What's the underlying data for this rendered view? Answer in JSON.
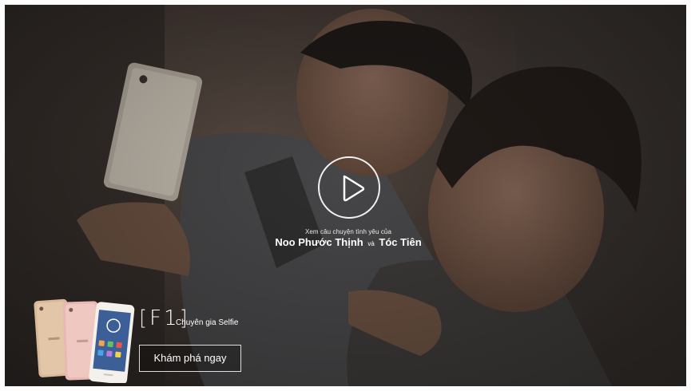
{
  "video": {
    "caption_line1": "Xem câu chuyện tình yêu của",
    "caption_name1": "Noo Phước Thịnh",
    "caption_connector": "và",
    "caption_name2": "Tóc Tiên",
    "play_icon": "play-icon"
  },
  "promo": {
    "logo_text": "F1",
    "tagline": "Chuyên gia Selfie",
    "cta_label": "Khám phá ngay",
    "phone_image_icon": "phone-product-image"
  },
  "colors": {
    "overlay": "#3a3431",
    "text": "#ffffff"
  }
}
